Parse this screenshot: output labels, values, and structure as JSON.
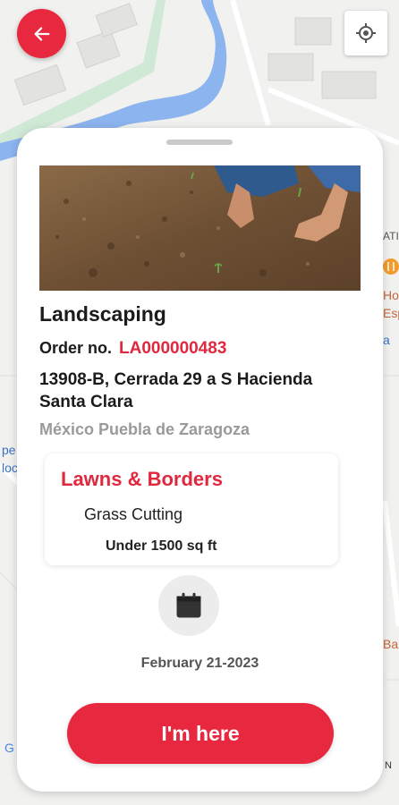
{
  "job": {
    "title": "Landscaping",
    "order_label": "Order no.",
    "order_number": "LA000000483",
    "address": "13908-B, Cerrada 29 a S Hacienda Santa Clara",
    "city": "México Puebla de Zaragoza"
  },
  "service": {
    "category": "Lawns & Borders",
    "name": "Grass Cutting",
    "size": "Under 1500 sq ft"
  },
  "schedule": {
    "date": "February 21-2023"
  },
  "actions": {
    "arrived_label": "I'm here"
  },
  "map": {
    "labels": [
      "ATI",
      "Ho",
      "Esp",
      "a",
      "pe",
      "loc",
      "Ba",
      "G",
      "N"
    ]
  },
  "colors": {
    "accent": "#e8283e",
    "order_number": "#e0283e",
    "muted": "#9a9a9a"
  },
  "icons": {
    "back": "arrow-left-icon",
    "locate": "crosshair-icon",
    "calendar": "calendar-icon"
  }
}
